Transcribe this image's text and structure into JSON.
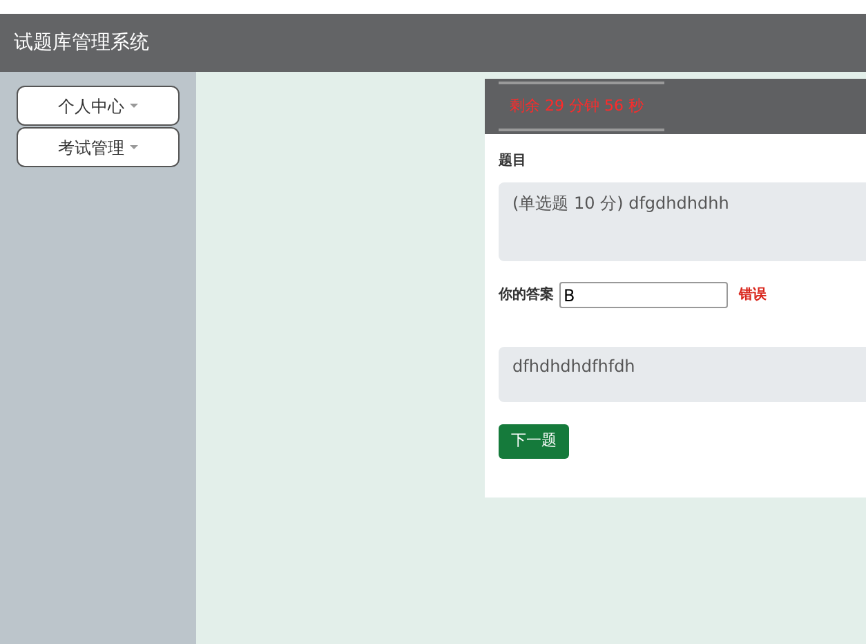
{
  "header": {
    "title": "试题库管理系统"
  },
  "sidebar": {
    "items": [
      {
        "label": "个人中心",
        "expanded": false
      },
      {
        "label": "考试管理",
        "expanded": false
      }
    ]
  },
  "exam": {
    "timer": "剩余 29 分钟 56 秒",
    "question_label": "题目",
    "question": "(单选题 10 分) dfgdhdhdhh",
    "answer_label": "你的答案",
    "answer_value": "B",
    "result": "错误",
    "correct_answer": "dfhdhdhdfhfdh",
    "next_button": "下一题"
  }
}
